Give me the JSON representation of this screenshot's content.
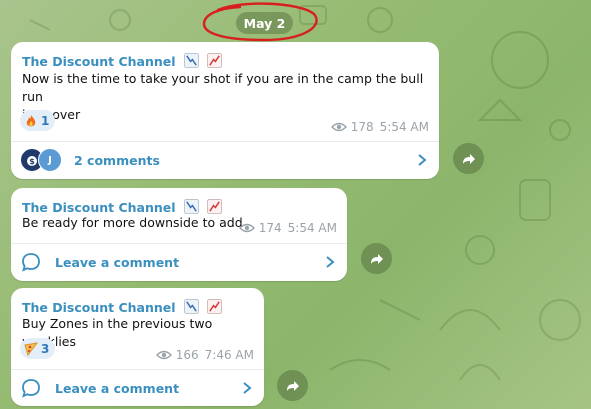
{
  "date_chip": "May 2",
  "colors": {
    "accent": "#3a8fbf",
    "meta_text": "#9aa3a9",
    "annotation_circle": "#d81e1e"
  },
  "posts": [
    {
      "channel": "The Discount Channel",
      "text_lines": [
        "Now is the time to take your shot if you are in the camp the bull run",
        "isn't over"
      ],
      "reaction": {
        "emoji": "fire",
        "count": "1"
      },
      "views": "178",
      "time": "5:54 AM",
      "comments_label": "2 comments",
      "commenter_avatars": [
        "money-bag-avatar",
        "J"
      ]
    },
    {
      "channel": "The Discount Channel",
      "text_lines": [
        "Be ready for more downside to add"
      ],
      "views": "174",
      "time": "5:54 AM",
      "comments_label": "Leave a comment"
    },
    {
      "channel": "The Discount Channel",
      "text_lines": [
        "Buy Zones in the previous two weeklies"
      ],
      "reaction": {
        "emoji": "pizza",
        "count": "3"
      },
      "views": "166",
      "time": "7:46 AM",
      "comments_label": "Leave a comment"
    }
  ]
}
